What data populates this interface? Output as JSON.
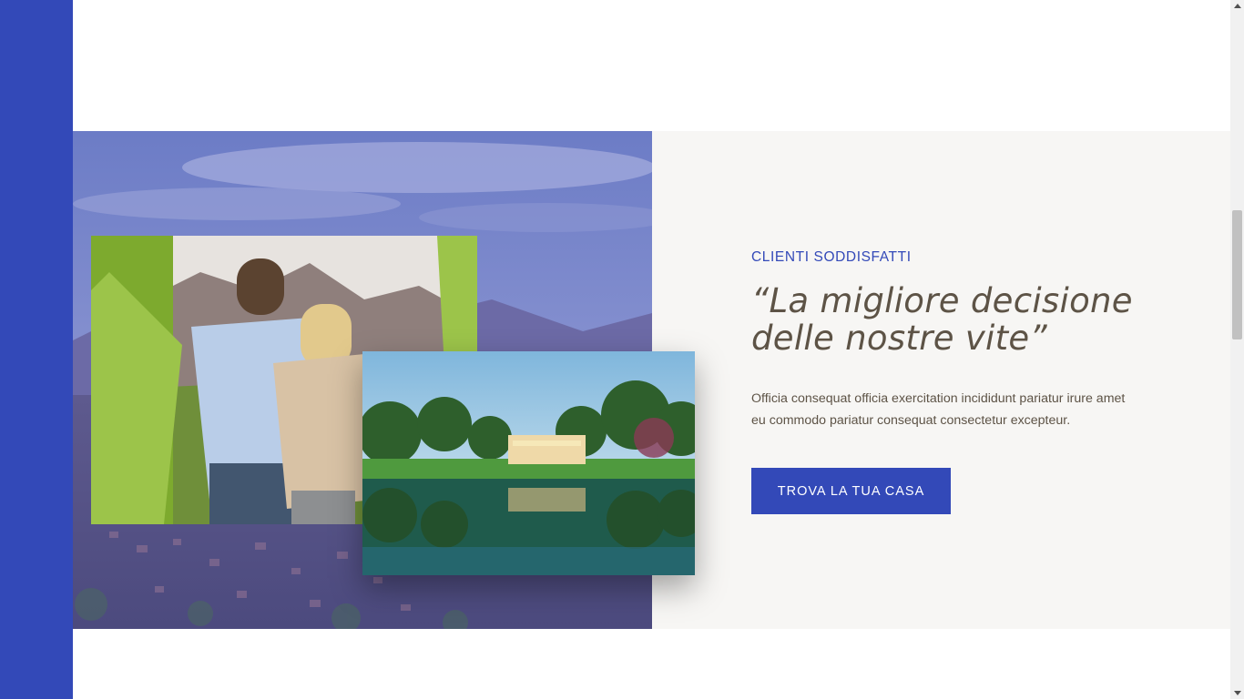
{
  "testimonial": {
    "eyebrow": "CLIENTI SODDISFATTI",
    "quote": "“La migliore decisione delle nostre vite”",
    "description": "Officia consequat officia exercitation incididunt pariatur irure amet eu commodo pariatur consequat consectetur excepteur.",
    "cta_label": "TROVA LA TUA CASA"
  },
  "colors": {
    "brand_blue": "#3349b8",
    "panel_bg": "#f7f6f4",
    "text_brown": "#5d5346"
  },
  "scrollbar": {
    "position_fraction": 0.35
  }
}
